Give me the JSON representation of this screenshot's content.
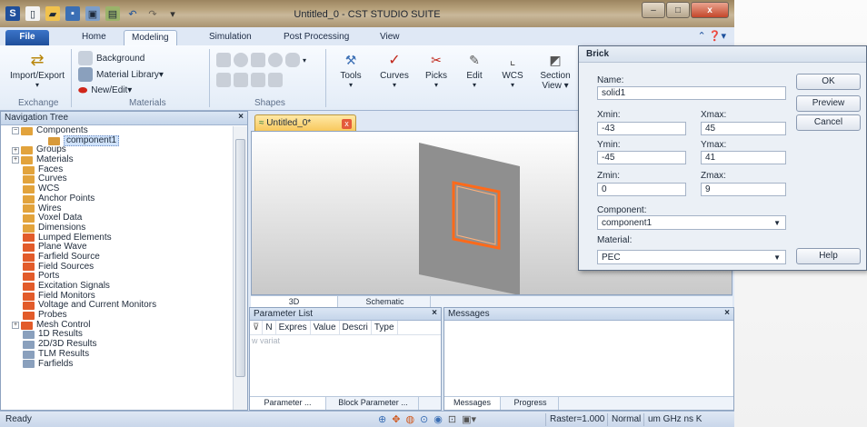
{
  "app_title": "Untitled_0 - CST STUDIO SUITE",
  "window_controls": {
    "minimize": "–",
    "maximize": "□",
    "close": "x"
  },
  "ribbon_tabs": [
    "File",
    "Home",
    "Modeling",
    "Simulation",
    "Post Processing",
    "View"
  ],
  "active_tab": "Modeling",
  "ribbon": {
    "import_export": "Import/Export",
    "exchange_label": "Exchange",
    "background": "Background",
    "material_library": "Material Library▾",
    "new_edit": "New/Edit▾",
    "materials_label": "Materials",
    "shapes_label": "Shapes",
    "tools": "Tools",
    "curves": "Curves",
    "picks": "Picks",
    "edit": "Edit",
    "wcs": "WCS",
    "section_view": "Section",
    "section_view2": "View ▾"
  },
  "nav_tree": {
    "title": "Navigation Tree",
    "close": "×",
    "items": [
      {
        "label": "Components",
        "exp": "−",
        "indent": 0,
        "color": "#e2a33c"
      },
      {
        "label": "component1",
        "exp": "",
        "indent": 1,
        "color": "#d89a3a",
        "selected": true
      },
      {
        "label": "Groups",
        "exp": "+",
        "indent": 0,
        "color": "#e2a33c"
      },
      {
        "label": "Materials",
        "exp": "+",
        "indent": 0,
        "color": "#e2a33c"
      },
      {
        "label": "Faces",
        "exp": "",
        "indent": 0,
        "color": "#e2a33c"
      },
      {
        "label": "Curves",
        "exp": "",
        "indent": 0,
        "color": "#e2a33c"
      },
      {
        "label": "WCS",
        "exp": "",
        "indent": 0,
        "color": "#e2a33c"
      },
      {
        "label": "Anchor Points",
        "exp": "",
        "indent": 0,
        "color": "#e2a33c"
      },
      {
        "label": "Wires",
        "exp": "",
        "indent": 0,
        "color": "#e2a33c"
      },
      {
        "label": "Voxel Data",
        "exp": "",
        "indent": 0,
        "color": "#e2a33c"
      },
      {
        "label": "Dimensions",
        "exp": "",
        "indent": 0,
        "color": "#e2a33c"
      },
      {
        "label": "Lumped Elements",
        "exp": "",
        "indent": 0,
        "color": "#e25b2a"
      },
      {
        "label": "Plane Wave",
        "exp": "",
        "indent": 0,
        "color": "#e25b2a"
      },
      {
        "label": "Farfield Source",
        "exp": "",
        "indent": 0,
        "color": "#e25b2a"
      },
      {
        "label": "Field Sources",
        "exp": "",
        "indent": 0,
        "color": "#e25b2a"
      },
      {
        "label": "Ports",
        "exp": "",
        "indent": 0,
        "color": "#e25b2a"
      },
      {
        "label": "Excitation Signals",
        "exp": "",
        "indent": 0,
        "color": "#e25b2a"
      },
      {
        "label": "Field Monitors",
        "exp": "",
        "indent": 0,
        "color": "#e25b2a"
      },
      {
        "label": "Voltage and Current Monitors",
        "exp": "",
        "indent": 0,
        "color": "#e25b2a"
      },
      {
        "label": "Probes",
        "exp": "",
        "indent": 0,
        "color": "#e25b2a"
      },
      {
        "label": "Mesh Control",
        "exp": "+",
        "indent": 0,
        "color": "#e25b2a"
      },
      {
        "label": "1D Results",
        "exp": "",
        "indent": 0,
        "color": "#8aa0bd"
      },
      {
        "label": "2D/3D Results",
        "exp": "",
        "indent": 0,
        "color": "#8aa0bd"
      },
      {
        "label": "TLM Results",
        "exp": "",
        "indent": 0,
        "color": "#8aa0bd"
      },
      {
        "label": "Farfields",
        "exp": "",
        "indent": 0,
        "color": "#8aa0bd"
      }
    ]
  },
  "doc_tab": {
    "label": "Untitled_0*",
    "close": "x"
  },
  "view_tabs": [
    "3D",
    "Schematic"
  ],
  "parameter_list": {
    "title": "Parameter List",
    "close": "×",
    "filter_icon": "⊽",
    "columns": [
      "N",
      "Expres",
      "Value",
      "Descri",
      "Type"
    ],
    "placeholder": "w variat",
    "bottom_tabs": [
      "Parameter ...",
      "Block Parameter ..."
    ]
  },
  "messages": {
    "title": "Messages",
    "close": "×",
    "bottom_tabs": [
      "Messages",
      "Progress"
    ]
  },
  "status": {
    "ready": "Ready",
    "raster": "Raster=1.000",
    "mode": "Normal",
    "units": "um GHz ns K"
  },
  "brick_dialog": {
    "title": "Brick",
    "name_label": "Name:",
    "name_value": "solid1",
    "xmin_label": "Xmin:",
    "xmin_value": "-43",
    "xmax_label": "Xmax:",
    "xmax_value": "45",
    "ymin_label": "Ymin:",
    "ymin_value": "-45",
    "ymax_label": "Ymax:",
    "ymax_value": "41",
    "zmin_label": "Zmin:",
    "zmin_value": "0",
    "zmax_label": "Zmax:",
    "zmax_value": "9",
    "component_label": "Component:",
    "component_value": "component1",
    "material_label": "Material:",
    "material_value": "PEC",
    "ok": "OK",
    "preview": "Preview",
    "cancel": "Cancel",
    "help": "Help"
  },
  "colors": {
    "ribbon_bg": "#e3ecf7",
    "accent": "#1f4f9b",
    "brick_outline": "#ff6a1a",
    "plane": "#8f8f8f"
  }
}
